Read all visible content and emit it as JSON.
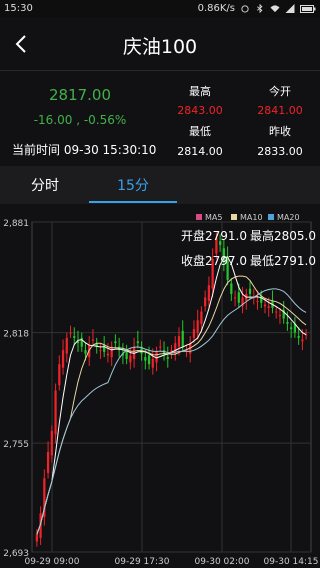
{
  "status": {
    "time": "15:30",
    "speed": "0.86K/s"
  },
  "header": {
    "title": "庆油100"
  },
  "quote": {
    "price": "2817.00",
    "change": "-16.00 , -0.56%",
    "time_label": "当前时间",
    "time_value": "09-30 15:30:10",
    "high_label": "最高",
    "high_value": "2843.00",
    "open_label": "今开",
    "open_value": "2841.00",
    "low_label": "最低",
    "low_value": "2814.00",
    "prev_label": "昨收",
    "prev_value": "2833.00"
  },
  "tabs": [
    {
      "label": "分时"
    },
    {
      "label": "15分",
      "active": true
    }
  ],
  "colors": {
    "up": "#f0222a",
    "down": "#24c62c",
    "ma5": "#ffffff",
    "ma10": "#e8d8a0",
    "ma20": "#9fc7d8",
    "accent": "#3aa0e8"
  },
  "ohlc_text": {
    "open": "开盘2791.0",
    "high": "最高2805.0",
    "close": "收盘2797.0",
    "low": "最低2791.0"
  },
  "chart_data": {
    "type": "candlestick",
    "y_ticks": [
      "2,881",
      "2,818",
      "2,755",
      "2,693"
    ],
    "ylim": [
      2693,
      2881
    ],
    "x_ticks": [
      "09-29 09:00",
      "09-29 17:30",
      "09-30 02:00",
      "09-30 14:15"
    ],
    "legend": [
      "MA5",
      "MA10",
      "MA20"
    ],
    "series": [
      {
        "name": "close",
        "values": [
          2703,
          2715,
          2735,
          2750,
          2762,
          2785,
          2800,
          2808,
          2815,
          2818,
          2815,
          2812,
          2810,
          2806,
          2811,
          2814,
          2810,
          2808,
          2807,
          2806,
          2810,
          2812,
          2808,
          2805,
          2803,
          2805,
          2810,
          2812,
          2806,
          2802,
          2800,
          2803,
          2807,
          2810,
          2806,
          2803,
          2808,
          2812,
          2816,
          2810,
          2808,
          2812,
          2820,
          2825,
          2830,
          2838,
          2845,
          2860,
          2872,
          2868,
          2858,
          2848,
          2840,
          2838,
          2835,
          2838,
          2840,
          2840,
          2838,
          2836,
          2835,
          2834,
          2833,
          2832,
          2830,
          2828,
          2826,
          2823,
          2820,
          2818,
          2815,
          2814,
          2817
        ]
      }
    ]
  }
}
